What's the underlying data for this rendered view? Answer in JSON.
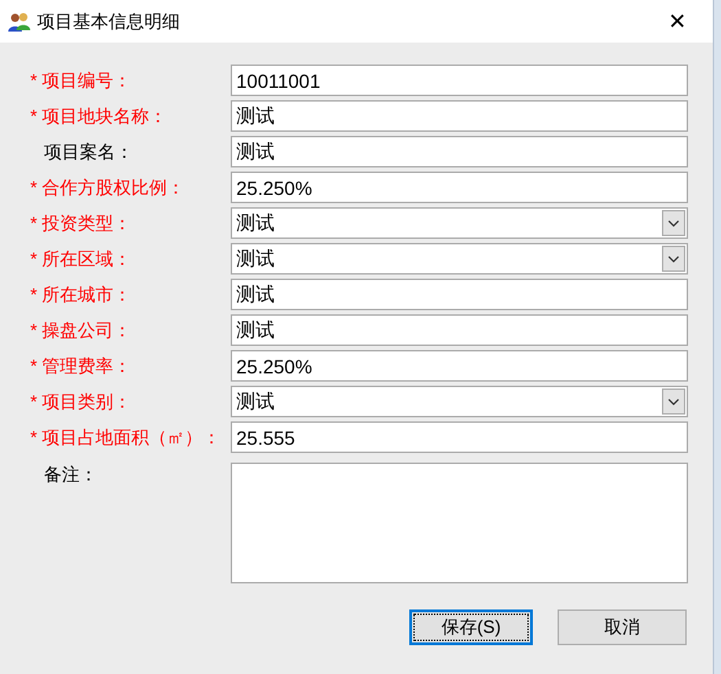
{
  "window": {
    "title": "项目基本信息明细",
    "close": "✕"
  },
  "fields": [
    {
      "label": "* 项目编号：",
      "required": true,
      "kind": "text",
      "value": "10011001"
    },
    {
      "label": "* 项目地块名称：",
      "required": true,
      "kind": "text",
      "value": "测试"
    },
    {
      "label": "项目案名：",
      "required": false,
      "kind": "text",
      "value": "测试"
    },
    {
      "label": "* 合作方股权比例：",
      "required": true,
      "kind": "text",
      "value": "25.250%"
    },
    {
      "label": "* 投资类型：",
      "required": true,
      "kind": "combo",
      "value": "测试"
    },
    {
      "label": "* 所在区域：",
      "required": true,
      "kind": "combo",
      "value": "测试"
    },
    {
      "label": "* 所在城市：",
      "required": true,
      "kind": "text",
      "value": "测试"
    },
    {
      "label": "* 操盘公司：",
      "required": true,
      "kind": "text",
      "value": "测试"
    },
    {
      "label": "* 管理费率：",
      "required": true,
      "kind": "text",
      "value": "25.250%"
    },
    {
      "label": "* 项目类别：",
      "required": true,
      "kind": "combo",
      "value": "测试"
    },
    {
      "label": "* 项目占地面积（㎡）：",
      "required": true,
      "kind": "text",
      "value": "25.555"
    },
    {
      "label": "备注：",
      "required": false,
      "kind": "memo"
    }
  ],
  "buttons": [
    {
      "label": "保存(S)",
      "focused": true
    },
    {
      "label": "取消",
      "focused": false
    }
  ]
}
